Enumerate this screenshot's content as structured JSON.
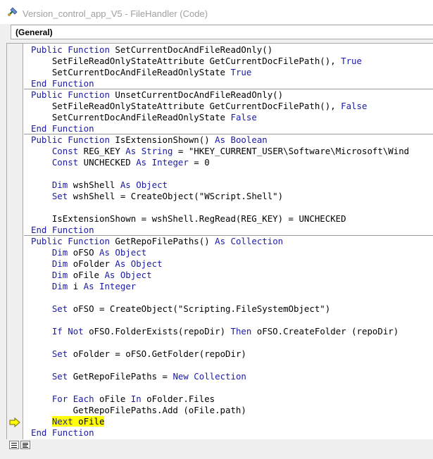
{
  "window": {
    "title": "Version_control_app_V5 - FileHandler (Code)",
    "app_icon": "vba-editor-icon"
  },
  "object_combo": {
    "selected": "(General)"
  },
  "code": {
    "keyword_color": "#1a1aa6",
    "highlight_color": "#ffff00",
    "current_line": "Next oFile",
    "lines": [
      "Public Function SetCurrentDocAndFileReadOnly()",
      "    SetFileReadOnlyStateAttribute GetCurrentDocFilePath(), True",
      "    SetCurrentDocAndFileReadOnlyState True",
      "End Function",
      "Public Function UnsetCurrentDocAndFileReadOnly()",
      "    SetFileReadOnlyStateAttribute GetCurrentDocFilePath(), False",
      "    SetCurrentDocAndFileReadOnlyState False",
      "End Function",
      "Public Function IsExtensionShown() As Boolean",
      "    Const REG_KEY As String = \"HKEY_CURRENT_USER\\Software\\Microsoft\\Wind",
      "    Const UNCHECKED As Integer = 0",
      "",
      "    Dim wshShell As Object",
      "    Set wshShell = CreateObject(\"WScript.Shell\")",
      "",
      "    IsExtensionShown = wshShell.RegRead(REG_KEY) = UNCHECKED",
      "End Function",
      "Public Function GetRepoFilePaths() As Collection",
      "    Dim oFSO As Object",
      "    Dim oFolder As Object",
      "    Dim oFile As Object",
      "    Dim i As Integer",
      "",
      "    Set oFSO = CreateObject(\"Scripting.FileSystemObject\")",
      "",
      "    If Not oFSO.FolderExists(repoDir) Then oFSO.CreateFolder (repoDir)",
      "",
      "    Set oFolder = oFSO.GetFolder(repoDir)",
      "",
      "    Set GetRepoFilePaths = New Collection",
      "",
      "    For Each oFile In oFolder.Files",
      "        GetRepoFilePaths.Add (oFile.path)",
      "    Next oFile",
      "End Function"
    ]
  },
  "bottom": {
    "procedure_view_icon": "procedure-view-icon",
    "full_module_view_icon": "full-module-view-icon"
  }
}
